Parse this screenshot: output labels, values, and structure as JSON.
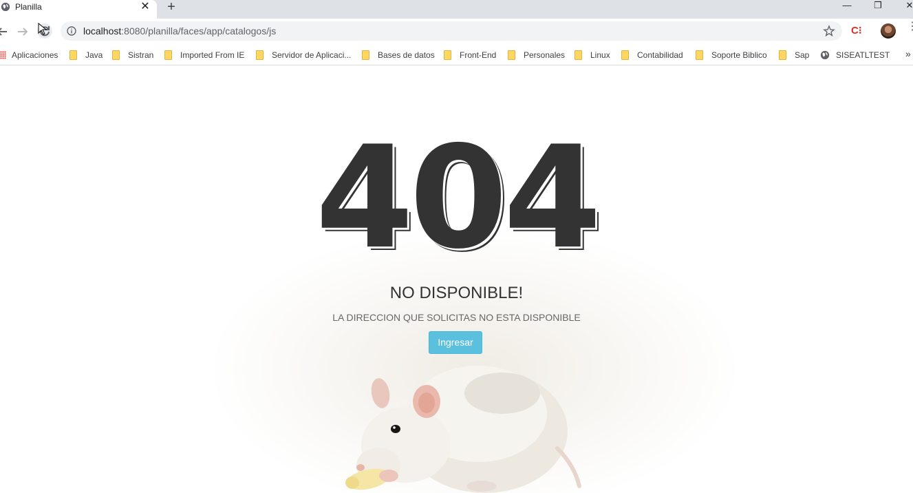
{
  "browser": {
    "tab": {
      "title": "Planilla",
      "close_glyph": "✕"
    },
    "new_tab_glyph": "+",
    "window": {
      "minimize": "—",
      "restore": "❐",
      "close": "✕"
    },
    "url": {
      "host": "localhost",
      "rest": ":8080/planilla/faces/app/catalogos/js"
    },
    "extension_label": "C⁝",
    "more_glyph": "⋮",
    "bookmarks": [
      {
        "label": "Aplicaciones",
        "icon": "apps-icon"
      },
      {
        "label": "Java",
        "icon": "folder-icon"
      },
      {
        "label": "Sistran",
        "icon": "folder-icon"
      },
      {
        "label": "Imported From IE",
        "icon": "folder-icon"
      },
      {
        "label": "Servidor de Aplicaci...",
        "icon": "folder-icon"
      },
      {
        "label": "Bases de datos",
        "icon": "folder-icon"
      },
      {
        "label": "Front-End",
        "icon": "folder-icon"
      },
      {
        "label": "Personales",
        "icon": "folder-icon"
      },
      {
        "label": "Linux",
        "icon": "folder-icon"
      },
      {
        "label": "Contabilidad",
        "icon": "folder-icon"
      },
      {
        "label": "Soporte Biblico",
        "icon": "folder-icon"
      },
      {
        "label": "Sap",
        "icon": "folder-icon"
      },
      {
        "label": "SISEATLTEST",
        "icon": "globe-icon"
      }
    ],
    "bookmarks_overflow": "»"
  },
  "page": {
    "code": "404",
    "title": "NO DISPONIBLE!",
    "subtitle": "LA DIRECCION QUE SOLICITAS NO ESTA DISPONIBLE",
    "button_label": "Ingresar",
    "colors": {
      "text": "#333333",
      "button": "#5bc0de"
    }
  }
}
